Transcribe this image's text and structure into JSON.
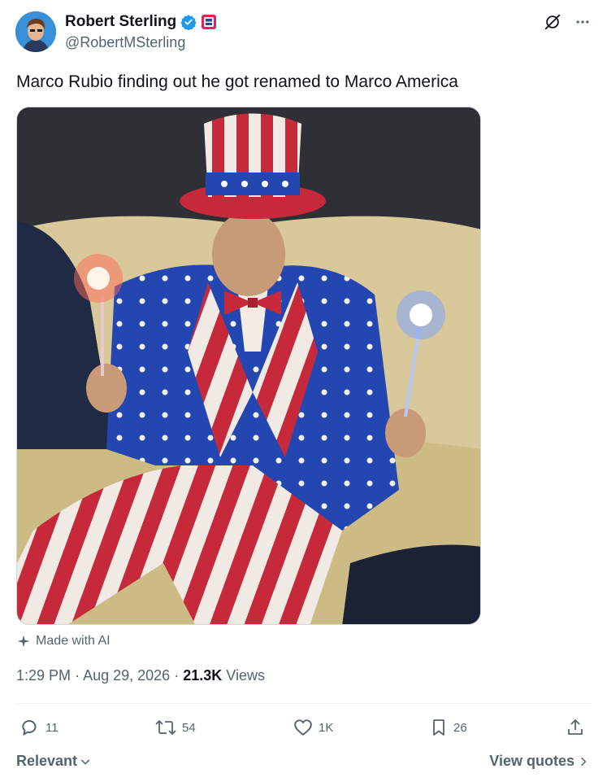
{
  "author": {
    "name": "Robert Sterling",
    "handle": "@RobertMSterling",
    "verified": true,
    "verified_color": "#1d9bf0",
    "avatar_icon": "avatar-cartoon-icon",
    "badge_icon": "affiliate-badge-icon"
  },
  "header_actions": {
    "grok_icon": "grok-icon",
    "more_icon": "more-icon"
  },
  "tweet": {
    "text": "Marco Rubio finding out he got renamed to Marco America"
  },
  "media": {
    "type": "photo",
    "description_icon": "uncle-sam-photo"
  },
  "ai_label": {
    "icon": "sparkle-icon",
    "text": "Made with AI"
  },
  "meta": {
    "time": "1:29 PM",
    "sep1": "·",
    "date": "Aug 29, 2026",
    "sep2": "·",
    "views_count": "21.3K",
    "views_label": "Views"
  },
  "actions": {
    "replies": "11",
    "reposts": "54",
    "likes": "1K",
    "bookmarks": "26"
  },
  "footer": {
    "relevant_label": "Relevant",
    "view_quotes_label": "View quotes"
  },
  "colors": {
    "text_primary": "#0f1419",
    "text_secondary": "#536471",
    "accent": "#1d9bf0"
  }
}
